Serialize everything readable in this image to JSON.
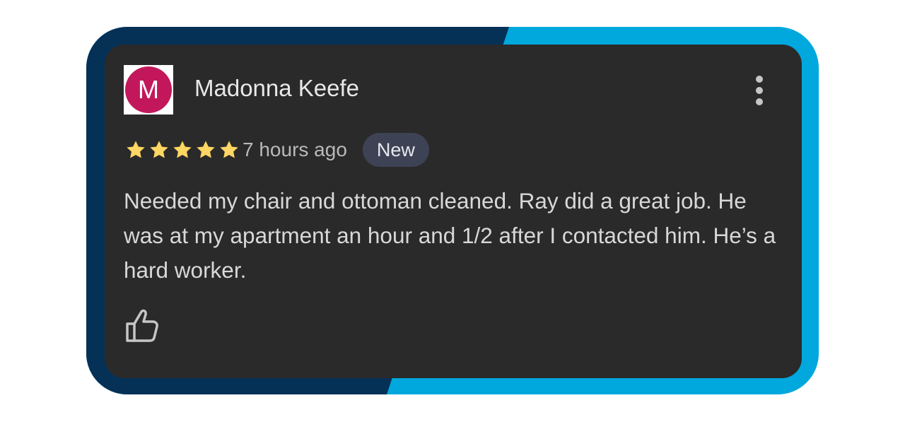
{
  "reviewer": {
    "name": "Madonna Keefe",
    "avatar_initial": "M",
    "avatar_color": "#c2185b"
  },
  "review": {
    "rating": 5,
    "rating_max": 5,
    "time_ago": "7 hours ago",
    "badge": "New",
    "text": "Needed my chair and ottoman cleaned. Ray did a great job. He was at my apartment an hour and 1/2 after I contacted him. He’s a hard worker."
  },
  "icons": {
    "menu": "more-vert-icon",
    "star": "star-icon",
    "like": "thumbs-up-icon"
  },
  "colors": {
    "card_background": "#2a2a2a",
    "frame_dark": "#063157",
    "frame_light": "#00a8dd",
    "star": "#fdd663",
    "badge_background": "#3d4354"
  }
}
